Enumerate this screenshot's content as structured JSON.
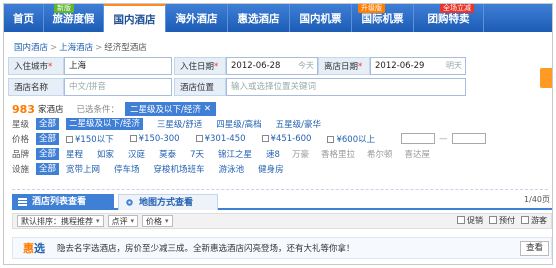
{
  "nav": {
    "items": [
      {
        "label": "首页",
        "badge": ""
      },
      {
        "label": "旅游度假",
        "badge": "新版"
      },
      {
        "label": "国内酒店",
        "badge": ""
      },
      {
        "label": "海外酒店",
        "badge": ""
      },
      {
        "label": "惠选酒店",
        "badge": ""
      },
      {
        "label": "国内机票",
        "badge": ""
      },
      {
        "label": "国际机票",
        "badge": "升级版"
      },
      {
        "label": "团购特卖",
        "badge": "全场立减"
      }
    ],
    "active_index": 2
  },
  "breadcrumb": {
    "root": "国内酒店",
    "city": "上海酒店",
    "current": "经济型酒店",
    "sep": ">"
  },
  "search": {
    "city_label": "入住城市",
    "city_value": "上海",
    "checkin_label": "入住日期",
    "checkin_value": "2012-06-28",
    "checkin_hint": "今天",
    "checkout_label": "离店日期",
    "checkout_value": "2012-06-29",
    "checkout_hint": "明天",
    "name_label": "酒店名称",
    "name_placeholder": "中文/拼音",
    "location_label": "酒店位置",
    "location_placeholder": "输入或选择位置关键词",
    "required_mark": "*"
  },
  "result": {
    "count": "983",
    "count_suffix": "家酒店",
    "cond_label": "已选条件：",
    "chip": "二星级及以下/经济",
    "chip_close": "✕"
  },
  "filters": {
    "all": "全部",
    "star": {
      "key": "星级",
      "options": [
        "二星级及以下/经济",
        "三星级/舒适",
        "四星级/高档",
        "五星级/豪华"
      ]
    },
    "price": {
      "key": "价格",
      "options": [
        "¥150以下",
        "¥150-300",
        "¥301-450",
        "¥451-600",
        "¥600以上"
      ]
    },
    "brand": {
      "key": "品牌",
      "options": [
        "如家",
        "星程",
        "汉庭",
        "莫泰",
        "7天",
        "锦江之星",
        "速8",
        "万豪",
        "香格里拉",
        "希尔顿",
        "喜达屋"
      ]
    },
    "facility": {
      "key": "设施",
      "options": [
        "宽带上网",
        "停车场",
        "穿梭机场班车",
        "游泳池",
        "健身房"
      ]
    }
  },
  "tabs": {
    "list": "酒店列表查看",
    "map": "地图方式查看",
    "pager": "1/40页"
  },
  "sort": {
    "default": "默认排序：携程推荐",
    "rating": "点评",
    "price": "价格",
    "checks": [
      "促销",
      "预付",
      "游客"
    ]
  },
  "promo": {
    "logo_a": "惠",
    "logo_b": "选",
    "text": "隐去名字选酒店，房价至少减三成。全新惠选酒店闪亮登场，还有大礼等你拿！",
    "button": "查看"
  },
  "colors": {
    "nav_blue": "#1d5cb5",
    "accent_orange": "#ff7a00",
    "filter_blue": "#3f7fd6"
  }
}
